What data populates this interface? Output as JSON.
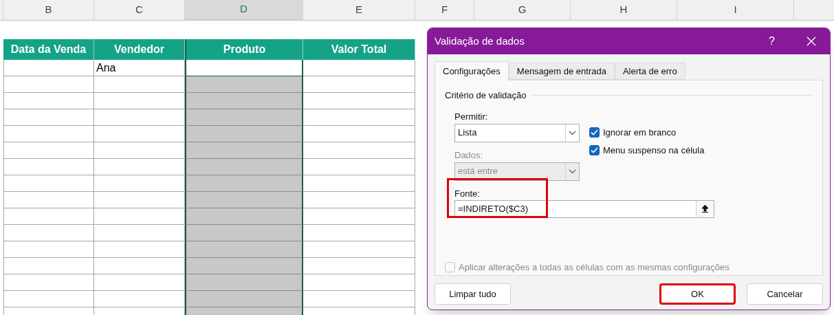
{
  "column_headers": [
    {
      "label": "B",
      "selected": false
    },
    {
      "label": "C",
      "selected": false
    },
    {
      "label": "D",
      "selected": true
    },
    {
      "label": "E",
      "selected": false
    },
    {
      "label": "F",
      "selected": false
    },
    {
      "label": "G",
      "selected": false
    },
    {
      "label": "H",
      "selected": false
    },
    {
      "label": "I",
      "selected": false
    }
  ],
  "table": {
    "headers": [
      "Data da Venda",
      "Vendedor",
      "Produto",
      "Valor Total"
    ],
    "rows": [
      {
        "column_2": "Ana"
      }
    ]
  },
  "dialog": {
    "title": "Validação de dados",
    "help": "?",
    "tabs": [
      {
        "label": "Configurações",
        "selected": true
      },
      {
        "label": "Mensagem de entrada",
        "selected": false
      },
      {
        "label": "Alerta de erro",
        "selected": false
      }
    ],
    "section": "Critério de validação",
    "allow": {
      "label": "Permitir:",
      "value": "Lista",
      "disabled": false
    },
    "data": {
      "label": "Dados:",
      "value": "está entre",
      "disabled": true
    },
    "checkboxes": [
      {
        "label": "Ignorar em branco",
        "checked": true
      },
      {
        "label": "Menu suspenso na célula",
        "checked": true
      }
    ],
    "source": {
      "label": "Fonte:",
      "value": "=INDIRETO($C3)",
      "highlighted": true
    },
    "apply_all": {
      "label": "Aplicar alterações a todas as células com as mesmas configurações",
      "checked": false,
      "disabled": true
    },
    "buttons": [
      {
        "label": "Limpar tudo",
        "highlighted": false
      },
      {
        "label": "OK",
        "highlighted": true
      },
      {
        "label": "Cancelar",
        "highlighted": false
      }
    ]
  }
}
